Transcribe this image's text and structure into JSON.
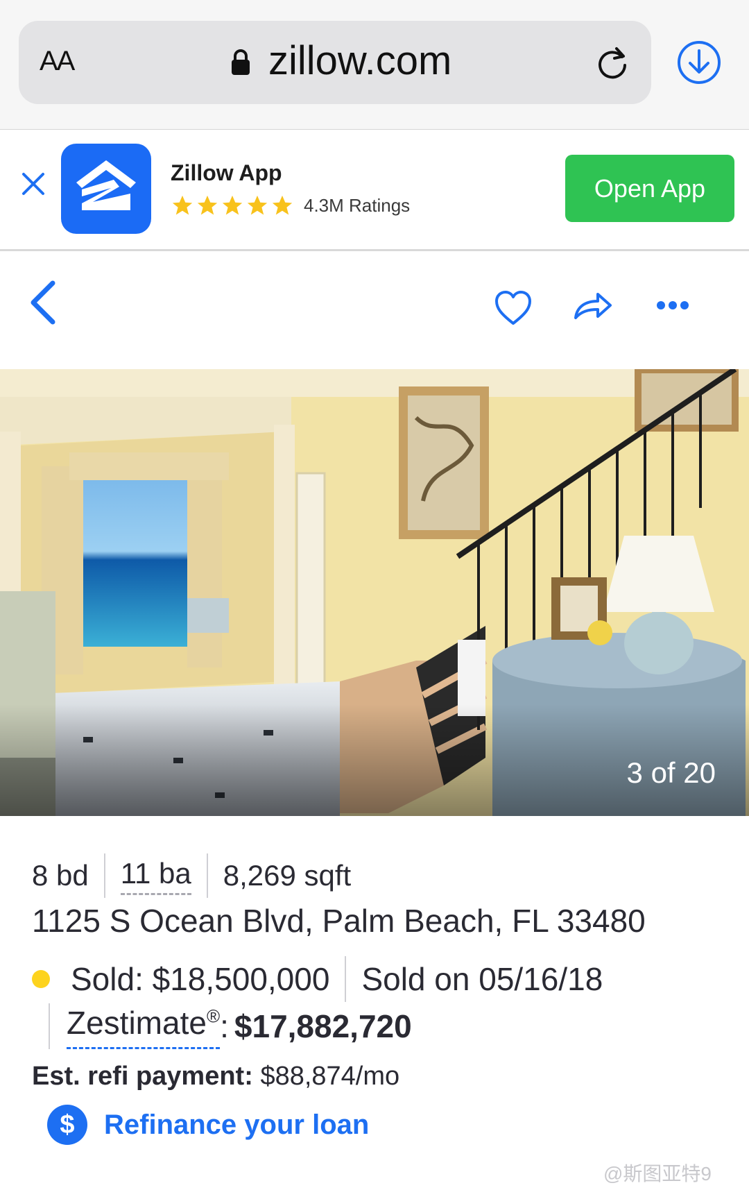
{
  "browser": {
    "text_size_label": "AA",
    "url": "zillow.com"
  },
  "app_banner": {
    "app_name": "Zillow App",
    "stars": 5,
    "ratings": "4.3M Ratings",
    "open_label": "Open App"
  },
  "photo": {
    "counter": "3 of 20"
  },
  "listing": {
    "beds": "8 bd",
    "baths": "11 ba",
    "sqft": "8,269 sqft",
    "address": "1125 S Ocean Blvd, Palm Beach, FL 33480",
    "sold_price": "Sold: $18,500,000",
    "sold_date": "Sold on 05/16/18",
    "zestimate_label": "Zestimate",
    "zestimate_reg": "®",
    "zestimate_colon": ":",
    "zestimate_value": "$17,882,720",
    "refi_label": "Est. refi payment:",
    "refi_value": "$88,874/mo",
    "refinance_link": "Refinance your loan"
  },
  "watermark": "@斯图亚特9",
  "colors": {
    "accent": "#1d6ff2",
    "open_button": "#2fc353",
    "star": "#f8c21c",
    "sold_dot": "#fdd31e",
    "app_icon": "#1b6bf5"
  },
  "icons": [
    "lock-icon",
    "reload-icon",
    "download-icon",
    "close-icon",
    "zillow-logo-icon",
    "star-icon",
    "back-chevron-icon",
    "heart-icon",
    "share-icon",
    "more-icon",
    "dollar-icon"
  ]
}
